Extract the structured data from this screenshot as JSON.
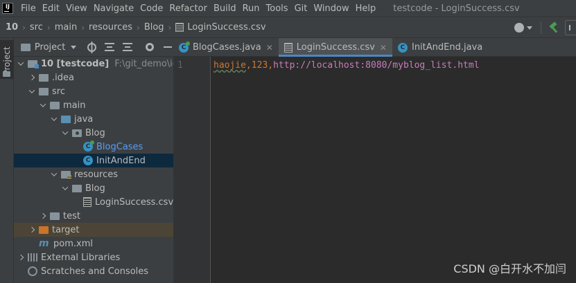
{
  "menubar": {
    "logo": "IJ",
    "items": [
      "File",
      "Edit",
      "View",
      "Navigate",
      "Code",
      "Refactor",
      "Build",
      "Run",
      "Tools",
      "Git",
      "Window",
      "Help"
    ],
    "window_title": "testcode - LoginSuccess.csv"
  },
  "breadcrumbs": [
    "10",
    "src",
    "main",
    "resources",
    "Blog",
    "LoginSuccess.csv"
  ],
  "project_panel": {
    "title": "Project",
    "tree": [
      {
        "label": "10 [testcode]",
        "hint": "F:\\git_demo\\idea_"
      },
      {
        "label": ".idea"
      },
      {
        "label": "src"
      },
      {
        "label": "main"
      },
      {
        "label": "java"
      },
      {
        "label": "Blog"
      },
      {
        "label": "BlogCases"
      },
      {
        "label": "InitAndEnd"
      },
      {
        "label": "resources"
      },
      {
        "label": "Blog"
      },
      {
        "label": "LoginSuccess.csv"
      },
      {
        "label": "test"
      },
      {
        "label": "target"
      },
      {
        "label": "pom.xml"
      },
      {
        "label": "External Libraries"
      },
      {
        "label": "Scratches and Consoles"
      }
    ]
  },
  "left_strip": {
    "label": "Project"
  },
  "tabs": [
    {
      "label": "BlogCases.java"
    },
    {
      "label": "LoginSuccess.csv"
    },
    {
      "label": "InitAndEnd.java"
    }
  ],
  "editor": {
    "line_number": "1",
    "tokens": [
      "haojie",
      ",",
      "123",
      ",",
      "http://localhost:8080/myblog_list.html"
    ]
  },
  "watermark": "CSDN @白开水不加闫",
  "colors": {
    "accent": "#4a88c7",
    "selection": "#0d293e",
    "keyword_orange": "#cc7832",
    "url_purple": "#c77dbb"
  }
}
